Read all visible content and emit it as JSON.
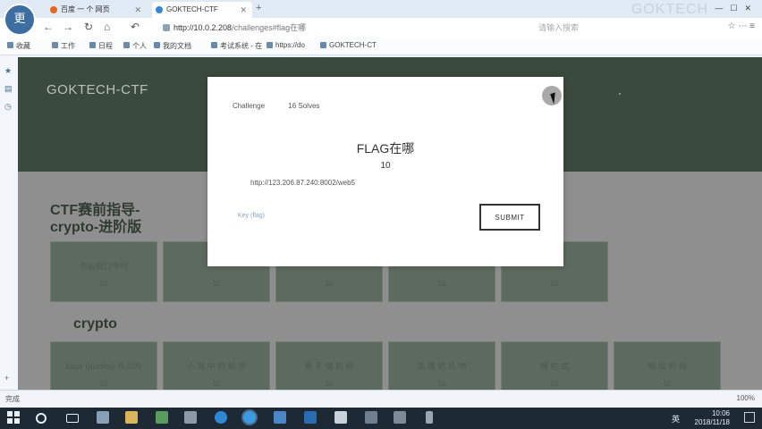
{
  "browser": {
    "avatar_label": "更",
    "tabs": [
      {
        "label": "百度 一 个 网页"
      },
      {
        "label": "GOKTECH-CTF"
      }
    ],
    "watermark": "GOKTECH",
    "address": {
      "host": "http://10.0.2.208",
      "path": "/challenges#flag在哪",
      "right_hint": "请输入搜索内容"
    },
    "bookmarks": [
      "收藏",
      "工作",
      "日程",
      "个人",
      "我的文档",
      "考试系统 - 在",
      "https://do",
      "GOKTECH-CT"
    ],
    "status_left": "完成",
    "status_right": "100%"
  },
  "site": {
    "logo": "GOKTECH-CTF",
    "categories": [
      {
        "title": "CTF赛前指导-crypto-进阶版",
        "cards": [
          {
            "name": "你会做口令吗",
            "points": "10"
          },
          {
            "name": "",
            "points": "10"
          },
          {
            "name": "",
            "points": "10"
          },
          {
            "name": "",
            "points": "10"
          },
          {
            "name": "",
            "points": "10"
          }
        ]
      },
      {
        "title": "crypto",
        "cards": [
          {
            "name": "base (bumbo) 乐高吗",
            "points": "10"
          },
          {
            "name": "小 城 中 的 秘 密",
            "points": "10"
          },
          {
            "name": "看 不 懂 的 码",
            "points": "10"
          },
          {
            "name": "凯 撒 的 礼 物",
            "points": "10"
          },
          {
            "name": "栅 栏 式",
            "points": "10"
          },
          {
            "name": "相 似 的 码",
            "points": "10"
          }
        ]
      }
    ]
  },
  "modal": {
    "tab_challenge": "Challenge",
    "tab_solves": "16 Solves",
    "title": "FLAG在哪",
    "value": "10",
    "url": "http://123.206.87.240:8002/web5",
    "input_placeholder": "Key (flag)",
    "submit_label": "SUBMIT"
  },
  "taskbar": {
    "lang": "英",
    "time": "10:06",
    "date": "2018/11/18"
  }
}
